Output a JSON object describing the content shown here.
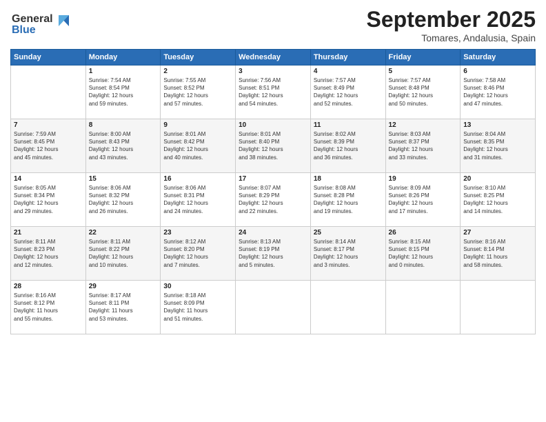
{
  "header": {
    "logo_line1": "General",
    "logo_line2": "Blue",
    "month": "September 2025",
    "location": "Tomares, Andalusia, Spain"
  },
  "days_of_week": [
    "Sunday",
    "Monday",
    "Tuesday",
    "Wednesday",
    "Thursday",
    "Friday",
    "Saturday"
  ],
  "weeks": [
    [
      {
        "day": "",
        "info": ""
      },
      {
        "day": "1",
        "info": "Sunrise: 7:54 AM\nSunset: 8:54 PM\nDaylight: 12 hours\nand 59 minutes."
      },
      {
        "day": "2",
        "info": "Sunrise: 7:55 AM\nSunset: 8:52 PM\nDaylight: 12 hours\nand 57 minutes."
      },
      {
        "day": "3",
        "info": "Sunrise: 7:56 AM\nSunset: 8:51 PM\nDaylight: 12 hours\nand 54 minutes."
      },
      {
        "day": "4",
        "info": "Sunrise: 7:57 AM\nSunset: 8:49 PM\nDaylight: 12 hours\nand 52 minutes."
      },
      {
        "day": "5",
        "info": "Sunrise: 7:57 AM\nSunset: 8:48 PM\nDaylight: 12 hours\nand 50 minutes."
      },
      {
        "day": "6",
        "info": "Sunrise: 7:58 AM\nSunset: 8:46 PM\nDaylight: 12 hours\nand 47 minutes."
      }
    ],
    [
      {
        "day": "7",
        "info": "Sunrise: 7:59 AM\nSunset: 8:45 PM\nDaylight: 12 hours\nand 45 minutes."
      },
      {
        "day": "8",
        "info": "Sunrise: 8:00 AM\nSunset: 8:43 PM\nDaylight: 12 hours\nand 43 minutes."
      },
      {
        "day": "9",
        "info": "Sunrise: 8:01 AM\nSunset: 8:42 PM\nDaylight: 12 hours\nand 40 minutes."
      },
      {
        "day": "10",
        "info": "Sunrise: 8:01 AM\nSunset: 8:40 PM\nDaylight: 12 hours\nand 38 minutes."
      },
      {
        "day": "11",
        "info": "Sunrise: 8:02 AM\nSunset: 8:39 PM\nDaylight: 12 hours\nand 36 minutes."
      },
      {
        "day": "12",
        "info": "Sunrise: 8:03 AM\nSunset: 8:37 PM\nDaylight: 12 hours\nand 33 minutes."
      },
      {
        "day": "13",
        "info": "Sunrise: 8:04 AM\nSunset: 8:35 PM\nDaylight: 12 hours\nand 31 minutes."
      }
    ],
    [
      {
        "day": "14",
        "info": "Sunrise: 8:05 AM\nSunset: 8:34 PM\nDaylight: 12 hours\nand 29 minutes."
      },
      {
        "day": "15",
        "info": "Sunrise: 8:06 AM\nSunset: 8:32 PM\nDaylight: 12 hours\nand 26 minutes."
      },
      {
        "day": "16",
        "info": "Sunrise: 8:06 AM\nSunset: 8:31 PM\nDaylight: 12 hours\nand 24 minutes."
      },
      {
        "day": "17",
        "info": "Sunrise: 8:07 AM\nSunset: 8:29 PM\nDaylight: 12 hours\nand 22 minutes."
      },
      {
        "day": "18",
        "info": "Sunrise: 8:08 AM\nSunset: 8:28 PM\nDaylight: 12 hours\nand 19 minutes."
      },
      {
        "day": "19",
        "info": "Sunrise: 8:09 AM\nSunset: 8:26 PM\nDaylight: 12 hours\nand 17 minutes."
      },
      {
        "day": "20",
        "info": "Sunrise: 8:10 AM\nSunset: 8:25 PM\nDaylight: 12 hours\nand 14 minutes."
      }
    ],
    [
      {
        "day": "21",
        "info": "Sunrise: 8:11 AM\nSunset: 8:23 PM\nDaylight: 12 hours\nand 12 minutes."
      },
      {
        "day": "22",
        "info": "Sunrise: 8:11 AM\nSunset: 8:22 PM\nDaylight: 12 hours\nand 10 minutes."
      },
      {
        "day": "23",
        "info": "Sunrise: 8:12 AM\nSunset: 8:20 PM\nDaylight: 12 hours\nand 7 minutes."
      },
      {
        "day": "24",
        "info": "Sunrise: 8:13 AM\nSunset: 8:19 PM\nDaylight: 12 hours\nand 5 minutes."
      },
      {
        "day": "25",
        "info": "Sunrise: 8:14 AM\nSunset: 8:17 PM\nDaylight: 12 hours\nand 3 minutes."
      },
      {
        "day": "26",
        "info": "Sunrise: 8:15 AM\nSunset: 8:15 PM\nDaylight: 12 hours\nand 0 minutes."
      },
      {
        "day": "27",
        "info": "Sunrise: 8:16 AM\nSunset: 8:14 PM\nDaylight: 11 hours\nand 58 minutes."
      }
    ],
    [
      {
        "day": "28",
        "info": "Sunrise: 8:16 AM\nSunset: 8:12 PM\nDaylight: 11 hours\nand 55 minutes."
      },
      {
        "day": "29",
        "info": "Sunrise: 8:17 AM\nSunset: 8:11 PM\nDaylight: 11 hours\nand 53 minutes."
      },
      {
        "day": "30",
        "info": "Sunrise: 8:18 AM\nSunset: 8:09 PM\nDaylight: 11 hours\nand 51 minutes."
      },
      {
        "day": "",
        "info": ""
      },
      {
        "day": "",
        "info": ""
      },
      {
        "day": "",
        "info": ""
      },
      {
        "day": "",
        "info": ""
      }
    ]
  ]
}
